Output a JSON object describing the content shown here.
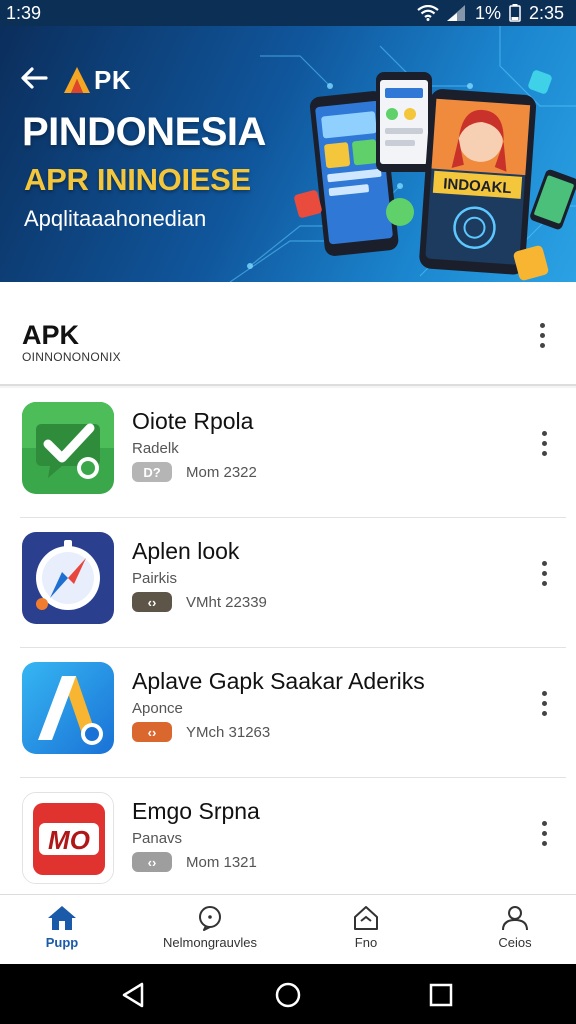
{
  "status_bar": {
    "time_left": "1:39",
    "battery": "1%",
    "time_right": "2:35"
  },
  "banner": {
    "logo_text": "PK",
    "title": "PINDONESIA",
    "subtitle": "APR ININOIESE",
    "caption": "Apqlitaaahonedian",
    "art_sign": "INDOAKL"
  },
  "section": {
    "title": "APK",
    "subtitle": "OINNONONONIX"
  },
  "apps": [
    {
      "name": "Oiote Rpola",
      "developer": "Radelk",
      "badge": "D?",
      "badge_color": "#b5b5b5",
      "meta": "Mom 2322",
      "icon": "check-chat-icon"
    },
    {
      "name": "Aplen look",
      "developer": "Pairkis",
      "badge": "‹›",
      "badge_color": "#5d5548",
      "meta": "VMht 22339",
      "icon": "compass-icon"
    },
    {
      "name": "Aplave Gapk Saakar Aderiks",
      "developer": "Aponce",
      "badge": "‹›",
      "badge_color": "#d9672e",
      "meta": "YMch 31263",
      "icon": "letter-a-icon"
    },
    {
      "name": "Emgo Srpna",
      "developer": "Panavs",
      "badge": "‹›",
      "badge_color": "#9e9e9e",
      "meta": "Mom 1321",
      "icon": "mo-logo-icon"
    }
  ],
  "bottom_nav": [
    {
      "label": "Pupp",
      "icon": "home-icon",
      "active": true
    },
    {
      "label": "Nelmongrauvles",
      "icon": "chat-bubble-icon",
      "active": false
    },
    {
      "label": "Fno",
      "icon": "house-outline-icon",
      "active": false
    },
    {
      "label": "Ceios",
      "icon": "person-icon",
      "active": false
    }
  ],
  "colors": {
    "status_bar": "#0c2f56",
    "banner_dark": "#0b2e5c",
    "banner_light": "#2ba2e4",
    "accent_yellow": "#f3c63c",
    "nav_active": "#1a5aa8"
  }
}
